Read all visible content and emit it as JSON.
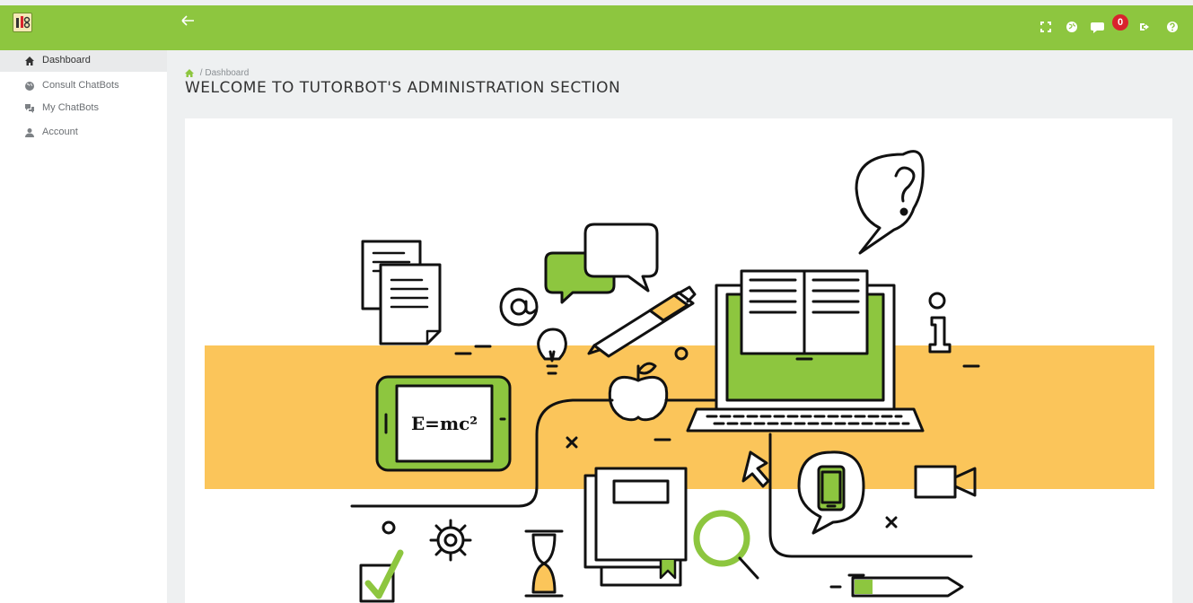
{
  "topbar": {
    "notifications_count": "0",
    "icons": [
      "fullscreen-icon",
      "globe-icon",
      "comments-icon",
      "logout-icon",
      "help-icon"
    ],
    "color": "#8dc63f"
  },
  "sidebar": {
    "items": [
      {
        "label": "Dashboard",
        "icon": "home-icon",
        "active": true
      },
      {
        "label": "Consult ChatBots",
        "icon": "globe-icon",
        "active": false
      },
      {
        "label": "My ChatBots",
        "icon": "chat-icon",
        "active": false
      },
      {
        "label": "Account",
        "icon": "user-icon",
        "active": false
      }
    ]
  },
  "breadcrumb": {
    "separator": "/",
    "current": "Dashboard"
  },
  "page": {
    "title": "WELCOME TO TUTORBOT'S ADMINISTRATION SECTION"
  },
  "illustration": {
    "formula": "E=mc²",
    "accent": "#fbc55a",
    "green": "#8dc63f"
  }
}
